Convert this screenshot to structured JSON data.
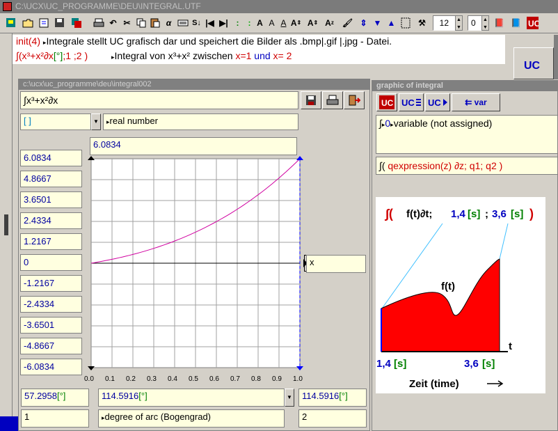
{
  "title": "C:\\UCX\\UC_PROGRAMME\\DEU\\INTEGRAL.UTF",
  "toolbar": {
    "font_size": "12",
    "second_value": "0"
  },
  "command": {
    "line1_fn": "init(4)",
    "line1_text": "Integrale stellt UC grafisch dar und speichert die Bilder als .bmp|.gif |.jpg - Datei.",
    "line2_expr_a": "∫(x³+x²∂x",
    "line2_expr_b": "[°]",
    "line2_expr_c": ";1 ;2 )",
    "line2_text_a": "Integral von x³+x² zwischen ",
    "line2_text_b": "x=1",
    "line2_text_c": " und ",
    "line2_text_d": "x= 2"
  },
  "left_window": {
    "title": "c:\\ucx\\uc_programme\\deu\\integral002",
    "expression": "∫x³+x²∂x",
    "type_select": "[ ]",
    "type_label": "real number",
    "top_value": "6.0834",
    "y_values": [
      "6.0834",
      "4.8667",
      "3.6501",
      "2.4334",
      "1.2167",
      "0",
      "-1.2167",
      "-2.4334",
      "-3.6501",
      "-4.8667",
      "-6.0834"
    ],
    "x_axis_label": "x",
    "x_ticks": [
      "0.0",
      "0.1",
      "0.2",
      "0.3",
      "0.4",
      "0.5",
      "0.6",
      "0.7",
      "0.8",
      "0.9",
      "1.0"
    ],
    "bottom": {
      "left_value": "57.2958",
      "left_unit": "[°]",
      "mid_value": "114.5916",
      "mid_unit": "[°]",
      "right_value": "114.5916",
      "right_unit": "[°]",
      "left_count": "1",
      "unit_label": "degree of arc (Bogengrad)",
      "right_count": "2"
    }
  },
  "right_window": {
    "title": "graphic of integral",
    "var_button": "var",
    "variable_line": "variable (not assigned)",
    "variable_index": "0",
    "template_a": "∫(",
    "template_b": "qexpression(z)",
    "template_c": "∂z; q1; q2 )",
    "image": {
      "formula_a": "∫(",
      "formula_b": "f(t)∂t;",
      "formula_c": "1,4",
      "formula_d": "[s]",
      "formula_e": ";",
      "formula_f": "3,6",
      "formula_g": "[s]",
      "formula_h": ")",
      "curve_label": "f(t)",
      "axis_t": "t",
      "left_val": "1,4",
      "left_unit": "[s]",
      "right_val": "3,6",
      "right_unit": "[s]",
      "xlabel": "Zeit (time)"
    }
  }
}
